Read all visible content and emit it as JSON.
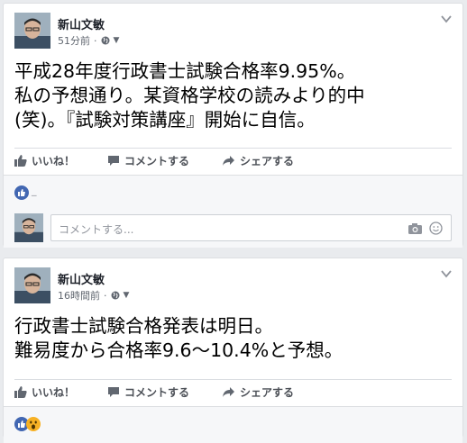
{
  "posts": [
    {
      "author": "新山文敏",
      "time": "51分前",
      "text_lines": [
        "平成28年度行政書士試験合格率9.95%。",
        "私の予想通り。某資格学校の読みより的中",
        "(笑)。『試験対策講座』開始に自信。"
      ],
      "reaction_dash": "_",
      "reactions": [
        "like"
      ]
    },
    {
      "author": "新山文敏",
      "time": "16時間前",
      "text_lines": [
        "行政書士試験合格発表は明日。",
        "難易度から合格率9.6〜10.4%と予想。"
      ],
      "reactions": [
        "like",
        "wow"
      ]
    }
  ],
  "actions": {
    "like": "いいね！",
    "comment": "コメントする",
    "share": "シェアする"
  },
  "comment_box": {
    "placeholder": "コメントする..."
  },
  "colors": {
    "background": "#e9ebee",
    "card": "#ffffff",
    "like_blue": "#3b5998",
    "meta_gray": "#616770",
    "action_gray": "#4b4f56"
  }
}
